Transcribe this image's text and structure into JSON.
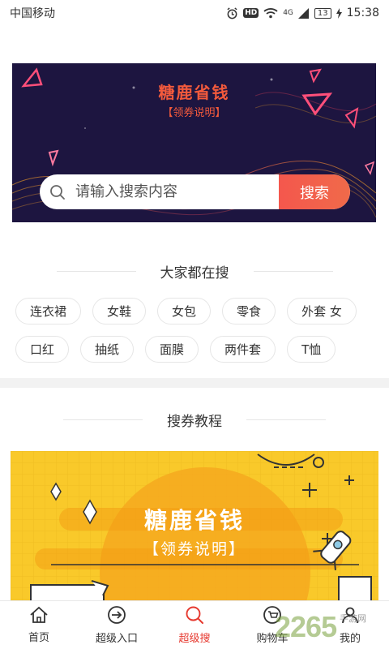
{
  "status_bar": {
    "carrier": "中国移动",
    "network": "4G",
    "hd": "HD",
    "battery": "13",
    "time": "15:38"
  },
  "banner": {
    "title": "糖鹿省钱",
    "subtitle": "【领券说明】",
    "search": {
      "placeholder": "请输入搜索内容",
      "button_label": "搜索"
    },
    "bg_color": "#1d1540",
    "accent_color": "#f35a3c"
  },
  "popular": {
    "title": "大家都在搜",
    "rows": [
      [
        "连衣裙",
        "女鞋",
        "女包",
        "零食",
        "外套 女"
      ],
      [
        "口红",
        "抽纸",
        "面膜",
        "两件套",
        "T恤"
      ]
    ]
  },
  "tutorial": {
    "section_title": "搜券教程",
    "title": "糖鹿省钱",
    "subtitle": "【领券说明】",
    "bg_color": "#f9c92a"
  },
  "bottom_nav": {
    "items": [
      {
        "label": "首页",
        "icon": "home-icon",
        "active": false
      },
      {
        "label": "超级入口",
        "icon": "entry-arrow-icon",
        "active": false
      },
      {
        "label": "超级搜",
        "icon": "search-icon",
        "active": true
      },
      {
        "label": "购物车",
        "icon": "cart-icon",
        "active": false
      },
      {
        "label": "我的",
        "icon": "user-icon",
        "active": false
      }
    ],
    "active_color": "#e6392f"
  },
  "watermark": {
    "number": "2265",
    "text": "手游网"
  }
}
